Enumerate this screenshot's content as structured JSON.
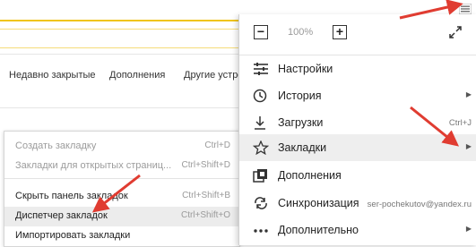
{
  "browser": {
    "bookmarks_bar": [
      "Недавно закрытые",
      "Дополнения",
      "Другие устро"
    ]
  },
  "main_menu": {
    "zoom": {
      "minus": "−",
      "value": "100%",
      "plus": "+"
    },
    "items": [
      {
        "label": "Настройки",
        "icon": "settings-sliders-icon"
      },
      {
        "label": "История",
        "icon": "clock-icon",
        "submenu": true
      },
      {
        "label": "Загрузки",
        "icon": "download-icon",
        "shortcut": "Ctrl+J"
      },
      {
        "label": "Закладки",
        "icon": "star-icon",
        "submenu": true
      },
      {
        "label": "Дополнения",
        "icon": "extensions-icon"
      },
      {
        "label": "Синхронизация",
        "icon": "sync-icon",
        "shortcut": "ser-pochekutov@yandex.ru"
      },
      {
        "label": "Дополнительно",
        "icon": "more-dots-icon",
        "submenu": true
      }
    ]
  },
  "bookmarks_submenu": {
    "items": [
      {
        "label": "Создать закладку",
        "shortcut": "Ctrl+D"
      },
      {
        "label": "Закладки для открытых страниц...",
        "shortcut": "Ctrl+Shift+D"
      },
      {
        "label": "Скрыть панель закладок",
        "shortcut": "Ctrl+Shift+B"
      },
      {
        "label": "Диспетчер закладок",
        "shortcut": "Ctrl+Shift+O"
      },
      {
        "label": "Импортировать закладки",
        "shortcut": ""
      }
    ]
  },
  "colors": {
    "accent_yellow": "#f0c419",
    "arrow_red": "#e03c31"
  }
}
